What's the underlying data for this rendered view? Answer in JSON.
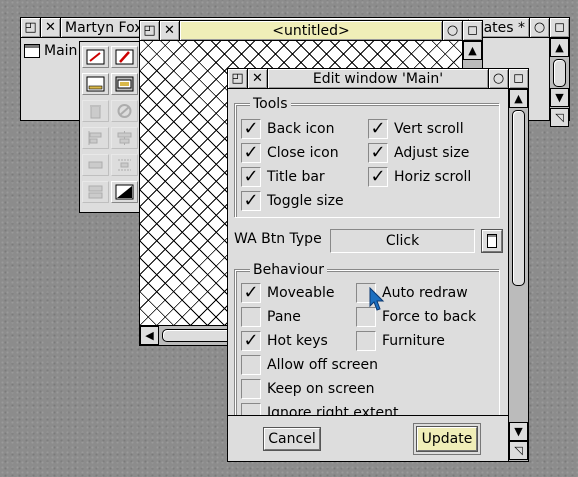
{
  "windows": {
    "templates": {
      "title": "Martyn Fox.",
      "title_right": "ates *",
      "file_item": "Main"
    },
    "untitled": {
      "title": "<untitled>"
    },
    "edit": {
      "title": "Edit window 'Main'"
    }
  },
  "edit_window": {
    "tools_group": {
      "label": "Tools",
      "options": [
        {
          "label": "Back icon",
          "checked": true
        },
        {
          "label": "Vert scroll",
          "checked": true
        },
        {
          "label": "Close icon",
          "checked": true
        },
        {
          "label": "Adjust size",
          "checked": true
        },
        {
          "label": "Title bar",
          "checked": true
        },
        {
          "label": "Horiz scroll",
          "checked": true
        },
        {
          "label": "Toggle size",
          "checked": true
        }
      ]
    },
    "wa_btn_type": {
      "label": "WA Btn Type",
      "value": "Click"
    },
    "behaviour_group": {
      "label": "Behaviour",
      "options": [
        {
          "label": "Moveable",
          "checked": true
        },
        {
          "label": "Auto redraw",
          "checked": false
        },
        {
          "label": "Pane",
          "checked": false
        },
        {
          "label": "Force to back",
          "checked": false
        },
        {
          "label": "Hot keys",
          "checked": true
        },
        {
          "label": "Furniture",
          "checked": false
        },
        {
          "label": "Allow off screen",
          "checked": false
        },
        {
          "label": "Keep on screen",
          "checked": false
        },
        {
          "label": "Ignore right extent",
          "checked": false
        }
      ]
    },
    "cancel_label": "Cancel",
    "update_label": "Update"
  },
  "glyphs": {
    "check": "✓",
    "close": "✕",
    "back": "◰",
    "toggle": "◻",
    "iconise": "○",
    "adjust": "◹",
    "up": "▲",
    "down": "▼",
    "left": "◀"
  },
  "colors": {
    "desktop": "#8c8c8c",
    "window": "#dddddd",
    "title_focus": "#f0eeb8",
    "pointer": "#1b6fc0"
  }
}
